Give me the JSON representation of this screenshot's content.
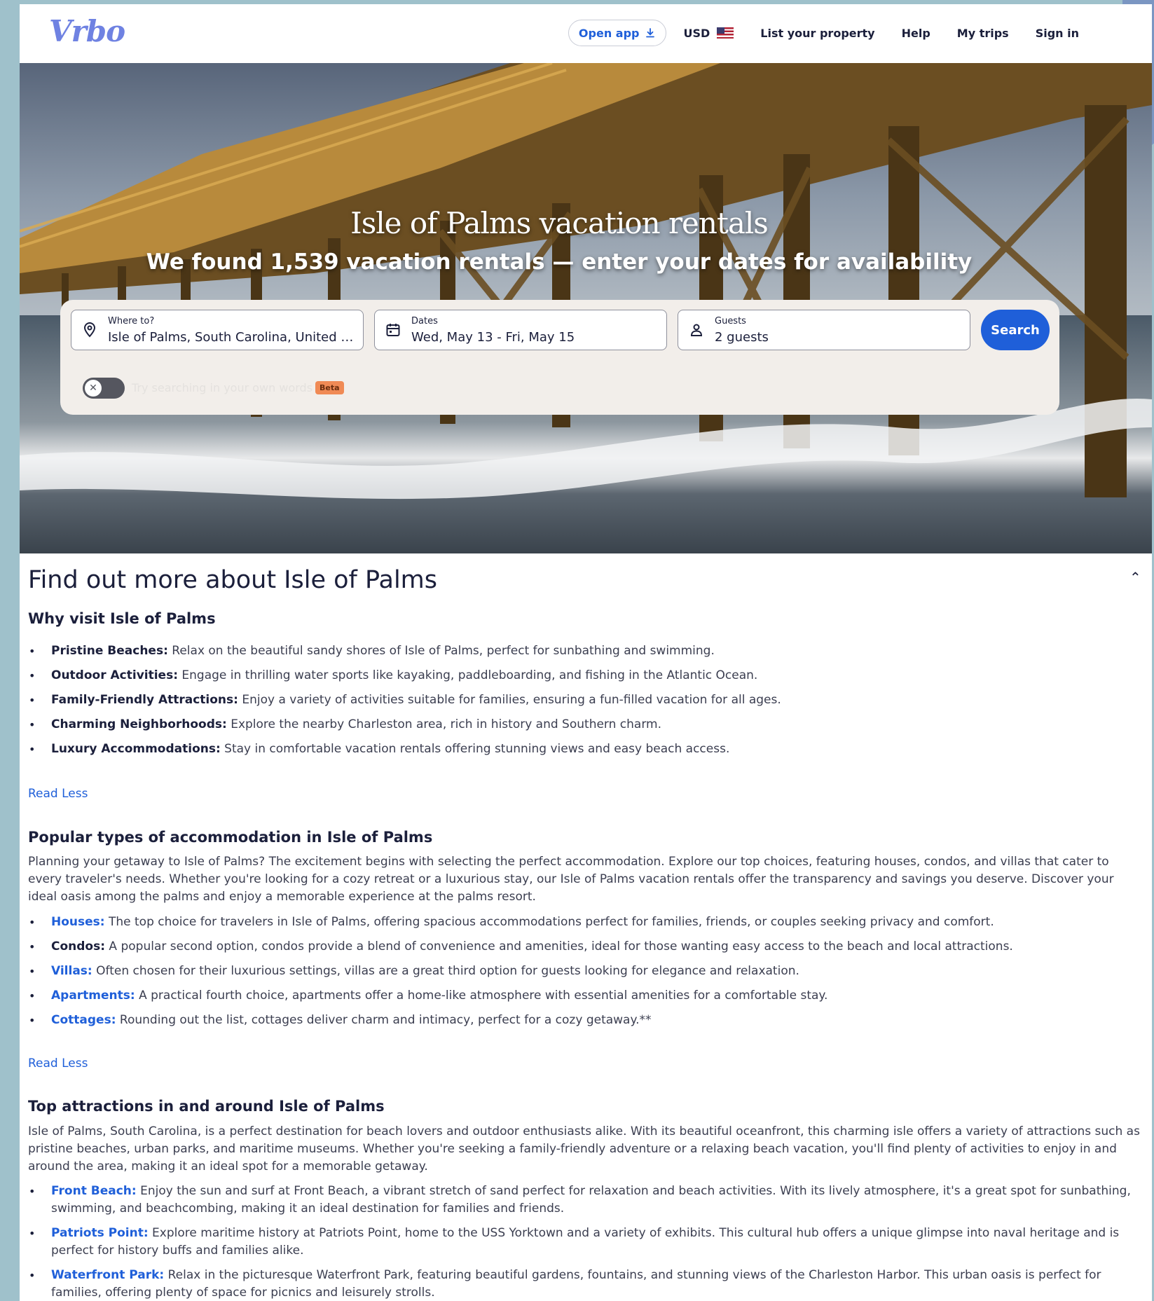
{
  "header": {
    "logo": "Vrbo",
    "open_app": "Open app",
    "currency": "USD",
    "nav": [
      "List your property",
      "Help",
      "My trips",
      "Sign in"
    ]
  },
  "hero": {
    "title": "Isle of Palms vacation rentals",
    "subtitle": "We found 1,539 vacation rentals — enter your dates for availability"
  },
  "search": {
    "where_label": "Where to?",
    "where_value": "Isle of Palms, South Carolina, United S...",
    "dates_label": "Dates",
    "dates_value": "Wed, May 13 - Fri, May 15",
    "guests_label": "Guests",
    "guests_value": "2 guests",
    "search_button": "Search",
    "toggle_text": "Try searching in your own words",
    "beta": "Beta"
  },
  "content": {
    "heading": "Find out more about Isle of Palms",
    "sections": [
      {
        "title": "Why visit Isle of Palms",
        "items": [
          {
            "term": "Pristine Beaches:",
            "text": " Relax on the beautiful sandy shores of Isle of Palms, perfect for sunbathing and swimming."
          },
          {
            "term": "Outdoor Activities:",
            "text": " Engage in thrilling water sports like kayaking, paddleboarding, and fishing in the Atlantic Ocean."
          },
          {
            "term": "Family-Friendly Attractions:",
            "text": " Enjoy a variety of activities suitable for families, ensuring a fun-filled vacation for all ages."
          },
          {
            "term": "Charming Neighborhoods:",
            "text": " Explore the nearby Charleston area, rich in history and Southern charm."
          },
          {
            "term": "Luxury Accommodations:",
            "text": " Stay in comfortable vacation rentals offering stunning views and easy beach access."
          }
        ],
        "read_less": "Read Less"
      },
      {
        "title": "Popular types of accommodation in Isle of Palms",
        "intro": "Planning your getaway to Isle of Palms? The excitement begins with selecting the perfect accommodation. Explore our top choices, featuring houses, condos, and villas that cater to every traveler's needs. Whether you're looking for a cozy retreat or a luxurious stay, our Isle of Palms vacation rentals offer the transparency and savings you deserve. Discover your ideal oasis among the palms and enjoy a memorable experience at the palms resort.",
        "items": [
          {
            "term": "Houses:",
            "text": " The top choice for travelers in Isle of Palms, offering spacious accommodations perfect for families, friends, or couples seeking privacy and comfort."
          },
          {
            "term": "Condos:",
            "text": " A popular second option, condos provide a blend of convenience and amenities, ideal for those wanting easy access to the beach and local attractions."
          },
          {
            "term": "Villas:",
            "text": " Often chosen for their luxurious settings, villas are a great third option for guests looking for elegance and relaxation."
          },
          {
            "term": "Apartments:",
            "text": " A practical fourth choice, apartments offer a home-like atmosphere with essential amenities for a comfortable stay."
          },
          {
            "term": "Cottages:",
            "text": " Rounding out the list, cottages deliver charm and intimacy, perfect for a cozy getaway.**"
          }
        ],
        "read_less": "Read Less"
      },
      {
        "title": "Top attractions in and around Isle of Palms",
        "intro": "Isle of Palms, South Carolina, is a perfect destination for beach lovers and outdoor enthusiasts alike. With its beautiful oceanfront, this charming isle offers a variety of attractions such as pristine beaches, urban parks, and maritime museums. Whether you're seeking a family-friendly adventure or a relaxing beach vacation, you'll find plenty of activities to enjoy in and around the area, making it an ideal spot for a memorable getaway.",
        "items": [
          {
            "term": "Front Beach:",
            "text": " Enjoy the sun and surf at Front Beach, a vibrant stretch of sand perfect for relaxation and beach activities. With its lively atmosphere, it's a great spot for sunbathing, swimming, and beachcombing, making it an ideal destination for families and friends."
          },
          {
            "term": "Patriots Point:",
            "text": " Explore maritime history at Patriots Point, home to the USS Yorktown and a variety of exhibits. This cultural hub offers a unique glimpse into naval heritage and is perfect for history buffs and families alike."
          },
          {
            "term": "Waterfront Park:",
            "text": " Relax in the picturesque Waterfront Park, featuring beautiful gardens, fountains, and stunning views of the Charleston Harbor. This urban oasis is perfect for families, offering plenty of space for picnics and leisurely strolls."
          }
        ]
      }
    ]
  },
  "colors": {
    "brand": "#6f82e2",
    "accent": "#1f5fd9",
    "text": "#1b1f3b"
  }
}
